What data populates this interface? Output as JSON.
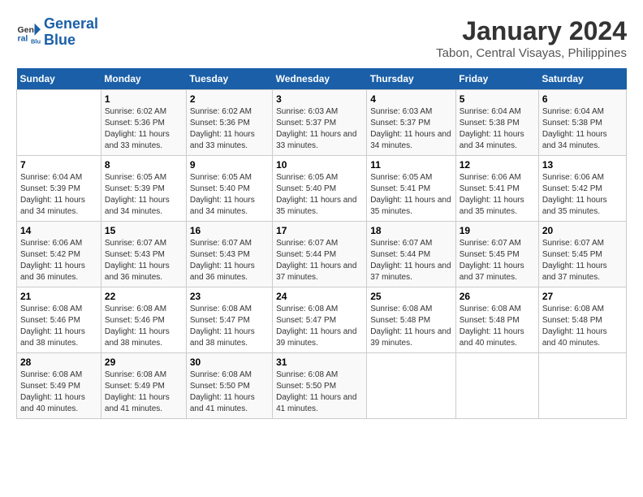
{
  "logo": {
    "text_general": "General",
    "text_blue": "Blue"
  },
  "title": "January 2024",
  "subtitle": "Tabon, Central Visayas, Philippines",
  "weekdays": [
    "Sunday",
    "Monday",
    "Tuesday",
    "Wednesday",
    "Thursday",
    "Friday",
    "Saturday"
  ],
  "weeks": [
    [
      {
        "day": "",
        "sunrise": "",
        "sunset": "",
        "daylight": ""
      },
      {
        "day": "1",
        "sunrise": "Sunrise: 6:02 AM",
        "sunset": "Sunset: 5:36 PM",
        "daylight": "Daylight: 11 hours and 33 minutes."
      },
      {
        "day": "2",
        "sunrise": "Sunrise: 6:02 AM",
        "sunset": "Sunset: 5:36 PM",
        "daylight": "Daylight: 11 hours and 33 minutes."
      },
      {
        "day": "3",
        "sunrise": "Sunrise: 6:03 AM",
        "sunset": "Sunset: 5:37 PM",
        "daylight": "Daylight: 11 hours and 33 minutes."
      },
      {
        "day": "4",
        "sunrise": "Sunrise: 6:03 AM",
        "sunset": "Sunset: 5:37 PM",
        "daylight": "Daylight: 11 hours and 34 minutes."
      },
      {
        "day": "5",
        "sunrise": "Sunrise: 6:04 AM",
        "sunset": "Sunset: 5:38 PM",
        "daylight": "Daylight: 11 hours and 34 minutes."
      },
      {
        "day": "6",
        "sunrise": "Sunrise: 6:04 AM",
        "sunset": "Sunset: 5:38 PM",
        "daylight": "Daylight: 11 hours and 34 minutes."
      }
    ],
    [
      {
        "day": "7",
        "sunrise": "Sunrise: 6:04 AM",
        "sunset": "Sunset: 5:39 PM",
        "daylight": "Daylight: 11 hours and 34 minutes."
      },
      {
        "day": "8",
        "sunrise": "Sunrise: 6:05 AM",
        "sunset": "Sunset: 5:39 PM",
        "daylight": "Daylight: 11 hours and 34 minutes."
      },
      {
        "day": "9",
        "sunrise": "Sunrise: 6:05 AM",
        "sunset": "Sunset: 5:40 PM",
        "daylight": "Daylight: 11 hours and 34 minutes."
      },
      {
        "day": "10",
        "sunrise": "Sunrise: 6:05 AM",
        "sunset": "Sunset: 5:40 PM",
        "daylight": "Daylight: 11 hours and 35 minutes."
      },
      {
        "day": "11",
        "sunrise": "Sunrise: 6:05 AM",
        "sunset": "Sunset: 5:41 PM",
        "daylight": "Daylight: 11 hours and 35 minutes."
      },
      {
        "day": "12",
        "sunrise": "Sunrise: 6:06 AM",
        "sunset": "Sunset: 5:41 PM",
        "daylight": "Daylight: 11 hours and 35 minutes."
      },
      {
        "day": "13",
        "sunrise": "Sunrise: 6:06 AM",
        "sunset": "Sunset: 5:42 PM",
        "daylight": "Daylight: 11 hours and 35 minutes."
      }
    ],
    [
      {
        "day": "14",
        "sunrise": "Sunrise: 6:06 AM",
        "sunset": "Sunset: 5:42 PM",
        "daylight": "Daylight: 11 hours and 36 minutes."
      },
      {
        "day": "15",
        "sunrise": "Sunrise: 6:07 AM",
        "sunset": "Sunset: 5:43 PM",
        "daylight": "Daylight: 11 hours and 36 minutes."
      },
      {
        "day": "16",
        "sunrise": "Sunrise: 6:07 AM",
        "sunset": "Sunset: 5:43 PM",
        "daylight": "Daylight: 11 hours and 36 minutes."
      },
      {
        "day": "17",
        "sunrise": "Sunrise: 6:07 AM",
        "sunset": "Sunset: 5:44 PM",
        "daylight": "Daylight: 11 hours and 37 minutes."
      },
      {
        "day": "18",
        "sunrise": "Sunrise: 6:07 AM",
        "sunset": "Sunset: 5:44 PM",
        "daylight": "Daylight: 11 hours and 37 minutes."
      },
      {
        "day": "19",
        "sunrise": "Sunrise: 6:07 AM",
        "sunset": "Sunset: 5:45 PM",
        "daylight": "Daylight: 11 hours and 37 minutes."
      },
      {
        "day": "20",
        "sunrise": "Sunrise: 6:07 AM",
        "sunset": "Sunset: 5:45 PM",
        "daylight": "Daylight: 11 hours and 37 minutes."
      }
    ],
    [
      {
        "day": "21",
        "sunrise": "Sunrise: 6:08 AM",
        "sunset": "Sunset: 5:46 PM",
        "daylight": "Daylight: 11 hours and 38 minutes."
      },
      {
        "day": "22",
        "sunrise": "Sunrise: 6:08 AM",
        "sunset": "Sunset: 5:46 PM",
        "daylight": "Daylight: 11 hours and 38 minutes."
      },
      {
        "day": "23",
        "sunrise": "Sunrise: 6:08 AM",
        "sunset": "Sunset: 5:47 PM",
        "daylight": "Daylight: 11 hours and 38 minutes."
      },
      {
        "day": "24",
        "sunrise": "Sunrise: 6:08 AM",
        "sunset": "Sunset: 5:47 PM",
        "daylight": "Daylight: 11 hours and 39 minutes."
      },
      {
        "day": "25",
        "sunrise": "Sunrise: 6:08 AM",
        "sunset": "Sunset: 5:48 PM",
        "daylight": "Daylight: 11 hours and 39 minutes."
      },
      {
        "day": "26",
        "sunrise": "Sunrise: 6:08 AM",
        "sunset": "Sunset: 5:48 PM",
        "daylight": "Daylight: 11 hours and 40 minutes."
      },
      {
        "day": "27",
        "sunrise": "Sunrise: 6:08 AM",
        "sunset": "Sunset: 5:48 PM",
        "daylight": "Daylight: 11 hours and 40 minutes."
      }
    ],
    [
      {
        "day": "28",
        "sunrise": "Sunrise: 6:08 AM",
        "sunset": "Sunset: 5:49 PM",
        "daylight": "Daylight: 11 hours and 40 minutes."
      },
      {
        "day": "29",
        "sunrise": "Sunrise: 6:08 AM",
        "sunset": "Sunset: 5:49 PM",
        "daylight": "Daylight: 11 hours and 41 minutes."
      },
      {
        "day": "30",
        "sunrise": "Sunrise: 6:08 AM",
        "sunset": "Sunset: 5:50 PM",
        "daylight": "Daylight: 11 hours and 41 minutes."
      },
      {
        "day": "31",
        "sunrise": "Sunrise: 6:08 AM",
        "sunset": "Sunset: 5:50 PM",
        "daylight": "Daylight: 11 hours and 41 minutes."
      },
      {
        "day": "",
        "sunrise": "",
        "sunset": "",
        "daylight": ""
      },
      {
        "day": "",
        "sunrise": "",
        "sunset": "",
        "daylight": ""
      },
      {
        "day": "",
        "sunrise": "",
        "sunset": "",
        "daylight": ""
      }
    ]
  ]
}
